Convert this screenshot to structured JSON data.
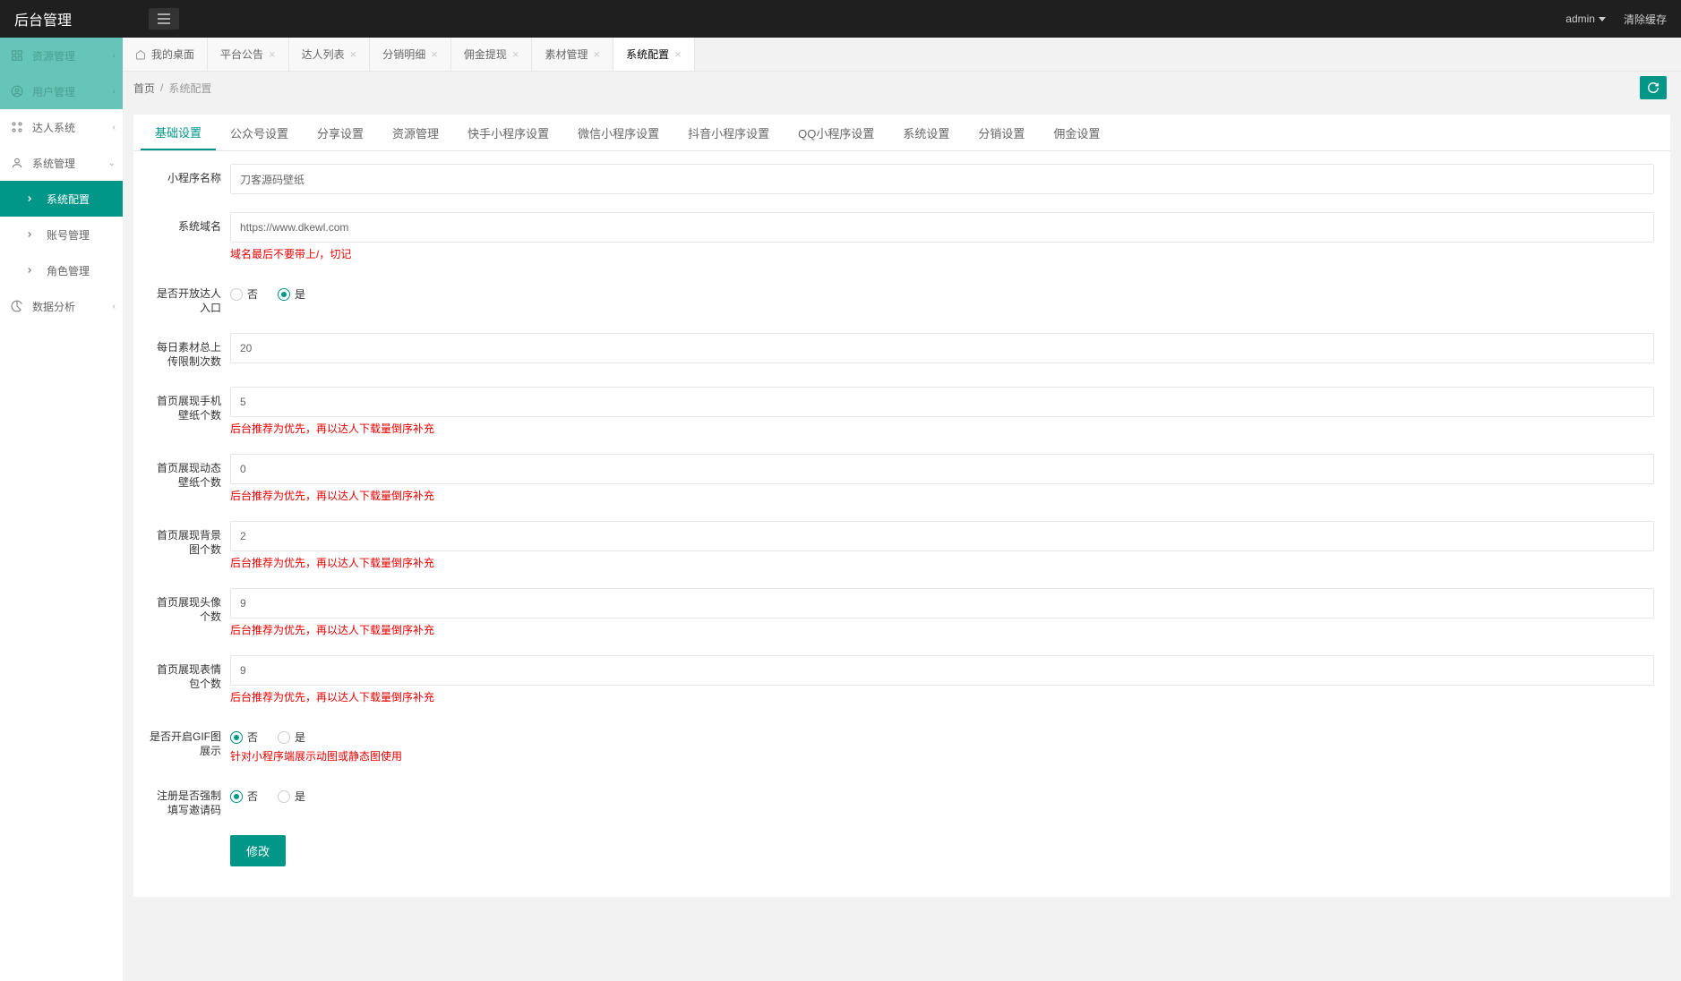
{
  "header": {
    "title": "后台管理",
    "user": "admin",
    "clear_cache": "清除缓存"
  },
  "sidebar": [
    {
      "label": "资源管理",
      "icon": "grid",
      "arrow": true,
      "state": "disabled"
    },
    {
      "label": "用户管理",
      "icon": "user-circle",
      "arrow": true,
      "state": "disabled"
    },
    {
      "label": "达人系统",
      "icon": "modules",
      "arrow": true,
      "state": ""
    },
    {
      "label": "系统管理",
      "icon": "user",
      "arrow": true,
      "state": "expanded"
    },
    {
      "label": "系统配置",
      "icon": "chevron",
      "arrow": false,
      "state": "active sub"
    },
    {
      "label": "账号管理",
      "icon": "chevron",
      "arrow": false,
      "state": "sub"
    },
    {
      "label": "角色管理",
      "icon": "chevron",
      "arrow": false,
      "state": "sub"
    },
    {
      "label": "数据分析",
      "icon": "pie",
      "arrow": true,
      "state": ""
    }
  ],
  "tabs": [
    {
      "label": "我的桌面",
      "home": true,
      "active": false
    },
    {
      "label": "平台公告",
      "home": false,
      "active": false
    },
    {
      "label": "达人列表",
      "home": false,
      "active": false
    },
    {
      "label": "分销明细",
      "home": false,
      "active": false
    },
    {
      "label": "佣金提现",
      "home": false,
      "active": false
    },
    {
      "label": "素材管理",
      "home": false,
      "active": false
    },
    {
      "label": "系统配置",
      "home": false,
      "active": true
    }
  ],
  "breadcrumb": {
    "home": "首页",
    "current": "系统配置"
  },
  "config_tabs": [
    "基础设置",
    "公众号设置",
    "分享设置",
    "资源管理",
    "快手小程序设置",
    "微信小程序设置",
    "抖音小程序设置",
    "QQ小程序设置",
    "系统设置",
    "分销设置",
    "佣金设置"
  ],
  "config_tabs_active": 0,
  "form": {
    "app_name": {
      "label": "小程序名称",
      "value": "刀客源码壁纸"
    },
    "domain": {
      "label": "系统域名",
      "value": "https://www.dkewl.com",
      "tip": "域名最后不要带上/，切记"
    },
    "open_daren": {
      "label": "是否开放达人入口",
      "options": [
        "否",
        "是"
      ],
      "selected": 1
    },
    "daily_upload": {
      "label": "每日素材总上传限制次数",
      "value": "20"
    },
    "home_phone": {
      "label": "首页展现手机壁纸个数",
      "value": "5",
      "tip": "后台推荐为优先，再以达人下载量倒序补充"
    },
    "home_dynamic": {
      "label": "首页展现动态壁纸个数",
      "value": "0",
      "tip": "后台推荐为优先，再以达人下载量倒序补充"
    },
    "home_bg": {
      "label": "首页展现背景图个数",
      "value": "2",
      "tip": "后台推荐为优先，再以达人下载量倒序补充"
    },
    "home_avatar": {
      "label": "首页展现头像个数",
      "value": "9",
      "tip": "后台推荐为优先，再以达人下载量倒序补充"
    },
    "home_emoji": {
      "label": "首页展现表情包个数",
      "value": "9",
      "tip": "后台推荐为优先，再以达人下载量倒序补充"
    },
    "gif": {
      "label": "是否开启GIF图展示",
      "options": [
        "否",
        "是"
      ],
      "selected": 0,
      "tip": "针对小程序端展示动图或静态图使用"
    },
    "invite": {
      "label": "注册是否强制填写邀请码",
      "options": [
        "否",
        "是"
      ],
      "selected": 0
    },
    "submit": "修改"
  }
}
